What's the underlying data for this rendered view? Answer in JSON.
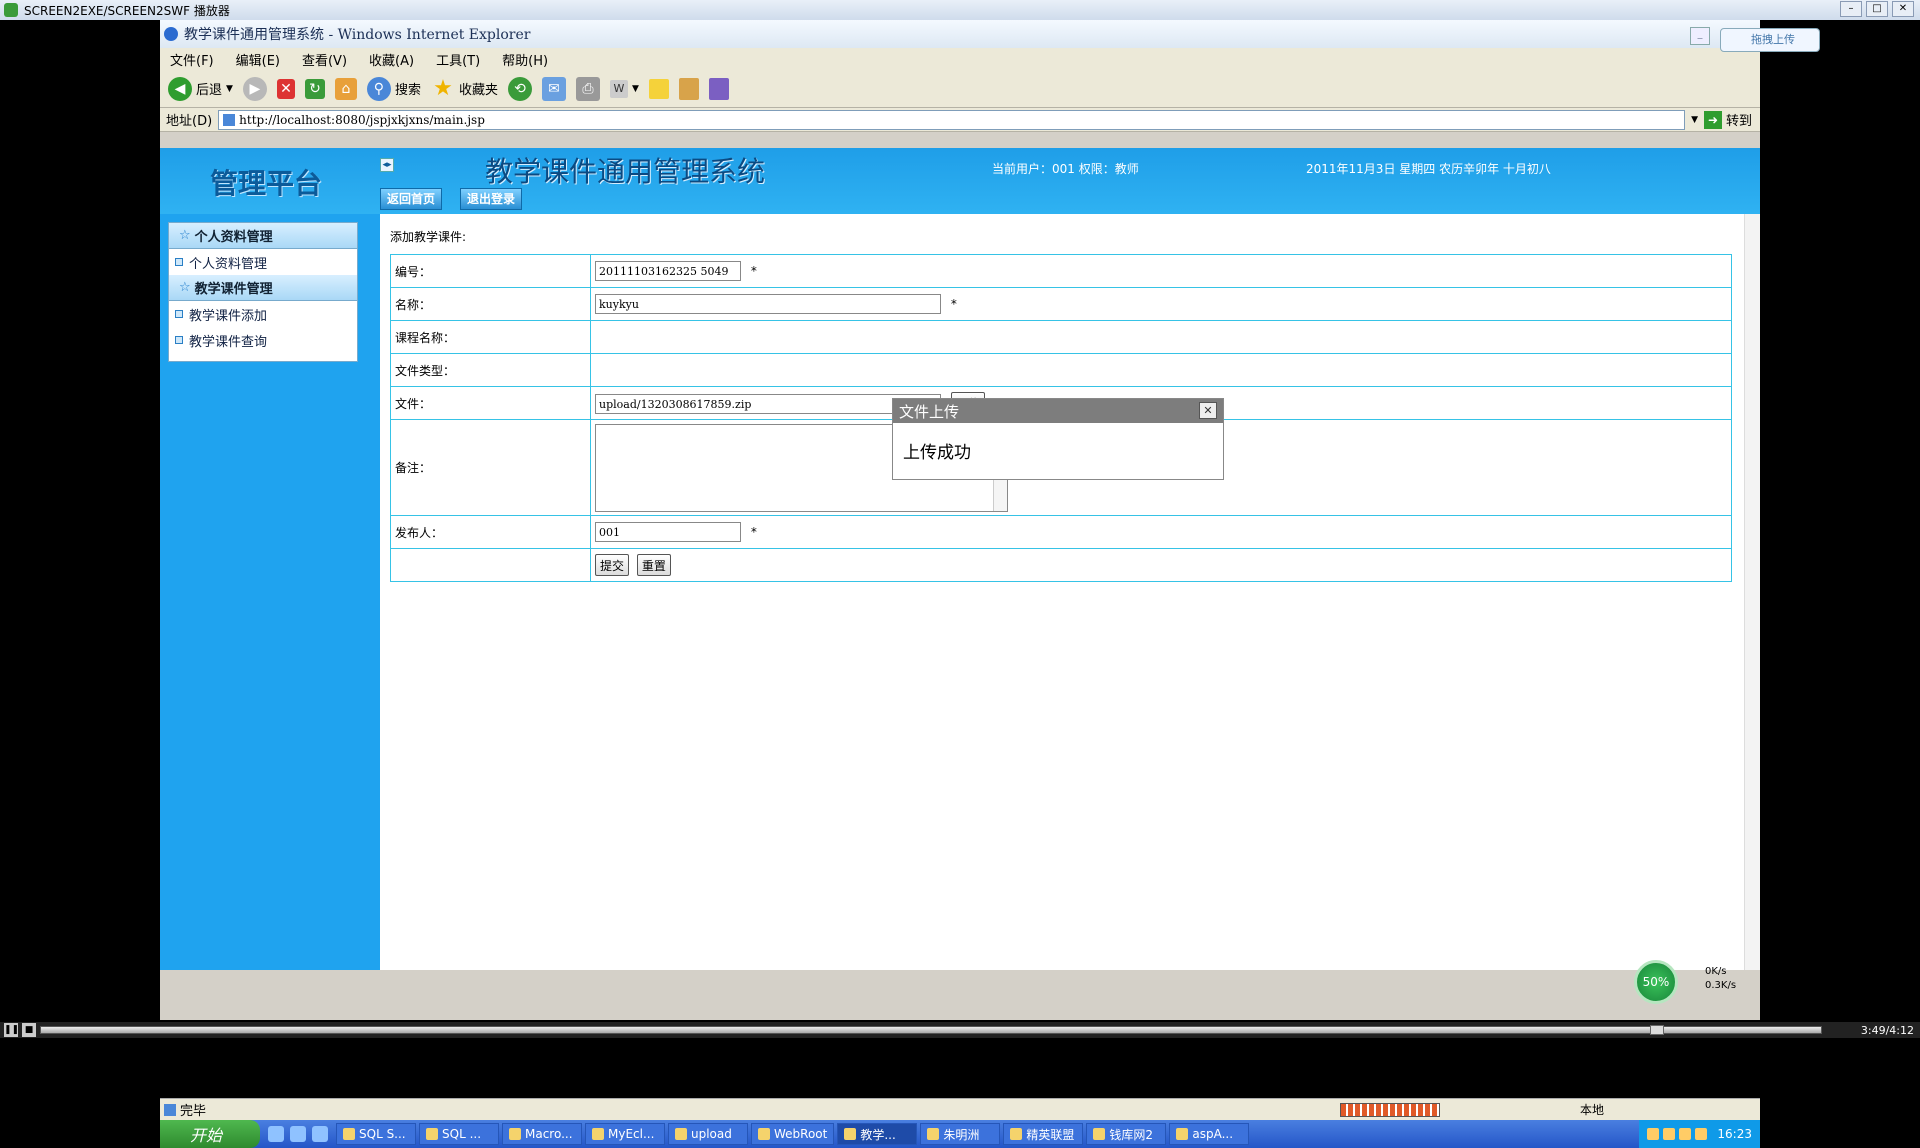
{
  "player": {
    "title": "SCREEN2EXE/SCREEN2SWF 播放器",
    "time": "3:49/4:12"
  },
  "ie": {
    "title": "教学课件通用管理系统 - Windows Internet Explorer",
    "upload_badge": "拖拽上传",
    "menu": [
      "文件(F)",
      "编辑(E)",
      "查看(V)",
      "收藏(A)",
      "工具(T)",
      "帮助(H)"
    ],
    "toolbar": {
      "back": "后退",
      "search": "搜索",
      "favorites": "收藏夹"
    },
    "address_label": "地址(D)",
    "address": "http://localhost:8080/jspjxkjxns/main.jsp",
    "go_label": "转到"
  },
  "banner": {
    "brand": "管理平台",
    "system_title": "教学课件通用管理系统",
    "user_info": "当前用户：001  权限：教师",
    "date_info": "2011年11月3日  星期四  农历辛卯年  十月初八",
    "nav": [
      "返回首页",
      "退出登录"
    ]
  },
  "sidebar": {
    "groups": [
      {
        "title": "个人资料管理",
        "items": [
          "个人资料管理"
        ]
      },
      {
        "title": "教学课件管理",
        "items": [
          "教学课件添加",
          "教学课件查询"
        ]
      }
    ]
  },
  "form": {
    "section_label": "添加教学课件:",
    "fields": {
      "id_label": "编号：",
      "id_value": "20111103162325 5049",
      "name_label": "名称：",
      "name_value": "kuykyu",
      "course_label": "课程名称：",
      "type_label": "文件类型：",
      "file_label": "文件：",
      "file_value": "upload/1320308617859.zip",
      "upload_button": "上传",
      "note_label": "备注：",
      "publisher_label": "发布人：",
      "publisher_value": "001",
      "required_mark": "*"
    },
    "submit": "提交",
    "reset": "重置"
  },
  "dialog": {
    "title": "文件上传",
    "message": "上传成功",
    "close": "✕"
  },
  "status": {
    "text": "完毕",
    "zone": "本地"
  },
  "taskbar": {
    "start": "开始",
    "tasks": [
      "SQL S...",
      "SQL ...",
      "Macro...",
      "MyEcl...",
      "upload",
      "WebRoot",
      "教学...",
      "朱明洲",
      "精英联盟",
      "钱库网2",
      "aspA..."
    ],
    "active_index": 6,
    "clock": "16:23",
    "speed_percent": "50%",
    "net_up": "0K/s",
    "net_down": "0.3K/s"
  },
  "colors": {
    "banner_blue": "#1fa3ef",
    "table_border": "#36c3e6",
    "dialog_header": "#7d7d7d"
  }
}
